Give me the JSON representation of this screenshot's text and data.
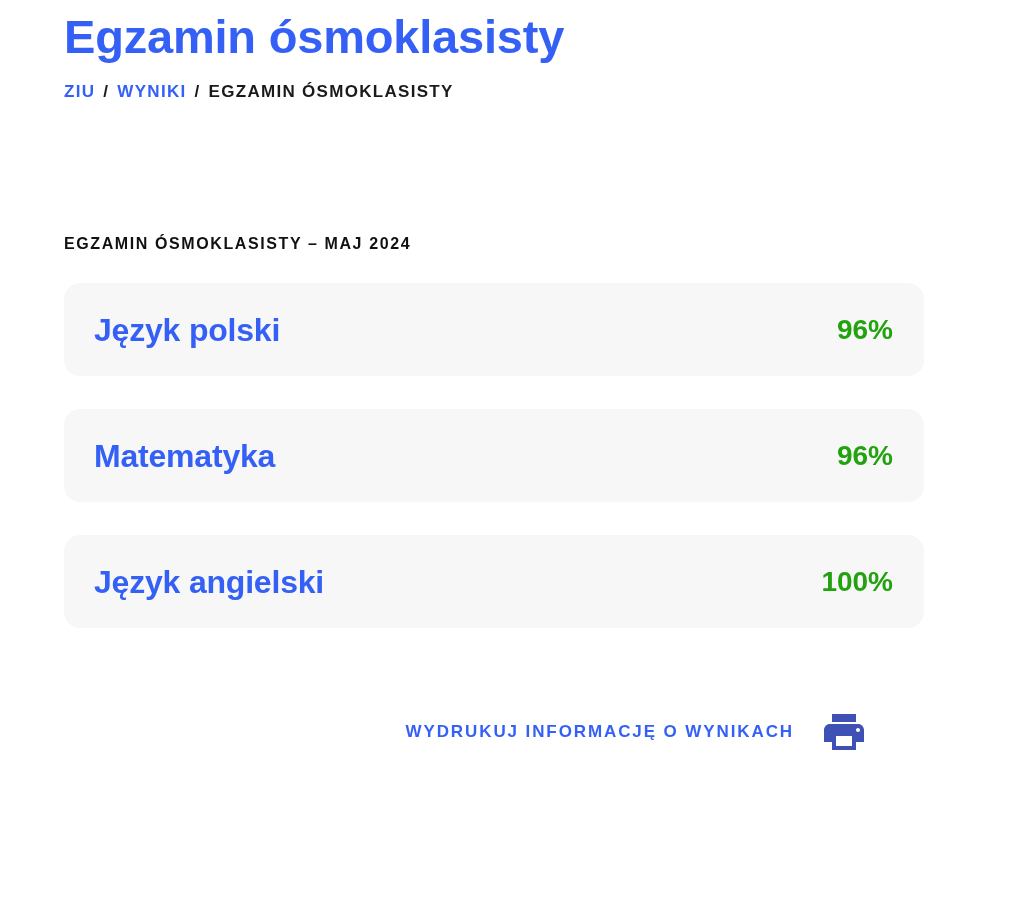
{
  "page": {
    "title": "Egzamin ósmoklasisty"
  },
  "breadcrumb": [
    {
      "kind": "link",
      "label": "ZIU"
    },
    {
      "kind": "separator",
      "label": "/"
    },
    {
      "kind": "link",
      "label": "WYNIKI"
    },
    {
      "kind": "separator",
      "label": "/"
    },
    {
      "kind": "current",
      "label": "EGZAMIN ÓSMOKLASISTY"
    }
  ],
  "section": {
    "heading": "EGZAMIN ÓSMOKLASISTY – MAJ 2024",
    "results": [
      {
        "subject": "Język polski",
        "score": "96%"
      },
      {
        "subject": "Matematyka",
        "score": "96%"
      },
      {
        "subject": "Język angielski",
        "score": "100%"
      }
    ]
  },
  "print_link": {
    "label": "WYDRUKUJ INFORMACJĘ O WYNIKACH"
  }
}
